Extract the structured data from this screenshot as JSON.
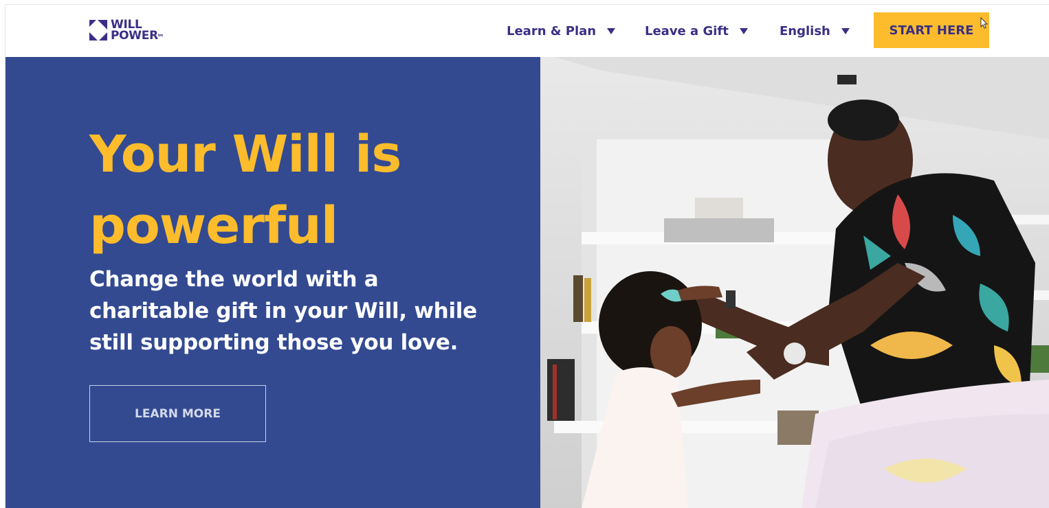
{
  "header": {
    "logo": {
      "line1": "WILL",
      "line2": "POWER",
      "mark": "tm"
    },
    "nav": [
      {
        "label": "Learn & Plan"
      },
      {
        "label": "Leave a Gift"
      },
      {
        "label": "English"
      }
    ],
    "cta_label": "START HERE"
  },
  "hero": {
    "title_line1": "Your Will is",
    "title_line2": "powerful",
    "subtitle_line1": "Change the world with a",
    "subtitle_line2": "charitable gift in your Will, while",
    "subtitle_line3": "still supporting those you love.",
    "learn_more_label": "LEARN MORE"
  },
  "colors": {
    "brand_purple": "#3a2f86",
    "hero_blue": "#334a91",
    "accent_yellow": "#fcbc2c"
  },
  "icons": [
    "willpower-logo-icon",
    "chevron-down-icon",
    "mouse-cursor-icon"
  ]
}
